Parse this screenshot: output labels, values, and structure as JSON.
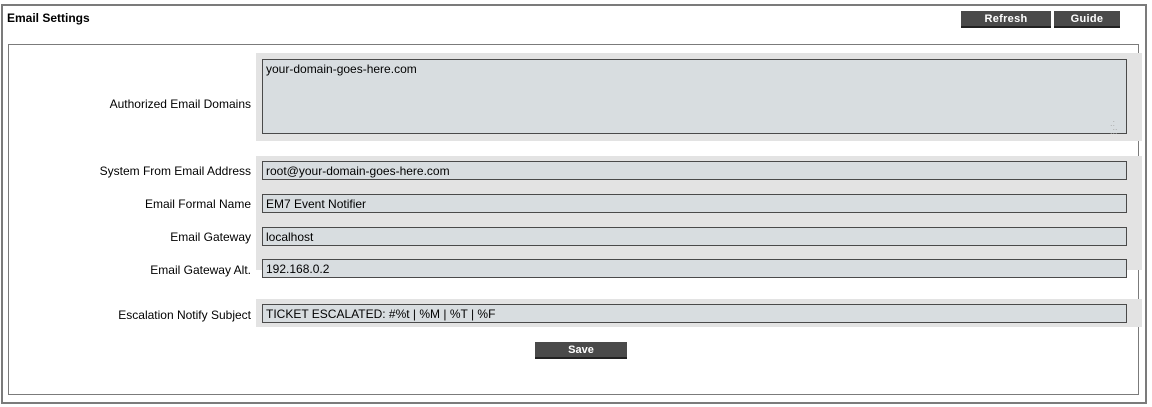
{
  "header": {
    "title": "Email Settings",
    "refresh_label": "Refresh",
    "guide_label": "Guide"
  },
  "fields": {
    "authorized_domains": {
      "label": "Authorized Email Domains",
      "value": "your-domain-goes-here.com"
    },
    "from_address": {
      "label": "System From Email Address",
      "value": "root@your-domain-goes-here.com"
    },
    "formal_name": {
      "label": "Email Formal Name",
      "value": "EM7 Event Notifier"
    },
    "gateway": {
      "label": "Email Gateway",
      "value": "localhost"
    },
    "gateway_alt": {
      "label": "Email Gateway Alt.",
      "value": "192.168.0.2"
    },
    "escalation_subject": {
      "label": "Escalation Notify Subject",
      "value": "TICKET ESCALATED: #%t | %M | %T | %F"
    }
  },
  "save_label": "Save",
  "colors": {
    "button_bg": "#4a4a4a",
    "field_bg": "#d8dde0",
    "row_bg": "#e3e3e3",
    "border": "#7b7b7b"
  }
}
